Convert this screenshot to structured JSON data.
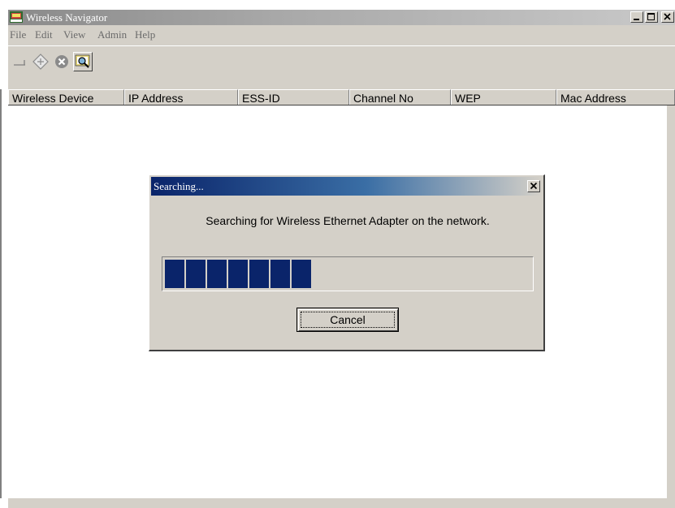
{
  "window": {
    "title": "Wireless Navigator",
    "controls": {
      "minimize": "_",
      "maximize": "□",
      "close": "×"
    }
  },
  "menu": [
    "File",
    "Edit",
    "View",
    "Admin",
    "Help"
  ],
  "toolbar": [
    {
      "icon": "connect-icon"
    },
    {
      "icon": "diamond-icon"
    },
    {
      "icon": "stop-icon"
    },
    {
      "icon": "search-device-icon"
    }
  ],
  "table": {
    "columns": [
      "Wireless Device",
      "IP Address",
      "ESS-ID",
      "Channel No",
      "WEP",
      "Mac Address"
    ],
    "rows": []
  },
  "dialog": {
    "title": "Searching...",
    "message": "Searching for Wireless Ethernet Adapter on the network.",
    "progress_percent": 40,
    "cancel_label": "Cancel"
  },
  "colors": {
    "progress_fill": "#0a246a",
    "dialog_title_start": "#0a246a",
    "window_face": "#d4d0c8"
  }
}
